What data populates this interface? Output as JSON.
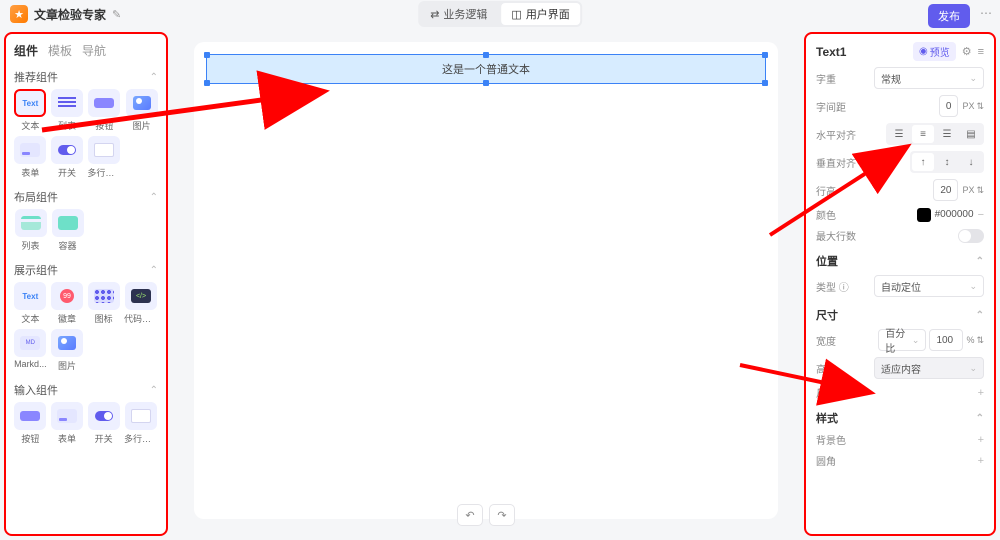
{
  "header": {
    "app_name": "文章检验专家",
    "tabs": {
      "logic": "业务逻辑",
      "ui": "用户界面"
    },
    "publish": "发布"
  },
  "left": {
    "tabs": {
      "components": "组件",
      "templates": "模板",
      "nav": "导航"
    },
    "group_reco": "推荐组件",
    "group_layout": "布局组件",
    "group_display": "展示组件",
    "group_input": "输入组件",
    "reco": {
      "text": "文本",
      "list": "列表",
      "button": "按钮",
      "image": "图片",
      "form": "表单",
      "switch": "开关",
      "multiline": "多行输..."
    },
    "layout": {
      "list": "列表",
      "container": "容器"
    },
    "display": {
      "text": "文本",
      "badge": "徽章",
      "chart": "图标",
      "code": "代码展...",
      "markdown": "Markd...",
      "image": "图片"
    },
    "input": {
      "button": "按钮",
      "form": "表单",
      "switch": "开关",
      "multiline": "多行输..."
    },
    "text_icon_label": "Text"
  },
  "canvas": {
    "text_content": "这是一个普通文本"
  },
  "right": {
    "title": "Text1",
    "preview": "预览",
    "font_weight_label": "字重",
    "font_weight_value": "常规",
    "letter_spacing_label": "字间距",
    "letter_spacing_value": "0",
    "letter_spacing_unit": "PX",
    "halign_label": "水平对齐",
    "valign_label": "垂直对齐",
    "line_height_label": "行高",
    "line_height_value": "20",
    "line_height_unit": "PX",
    "color_label": "颜色",
    "color_value": "#000000",
    "max_lines_label": "最大行数",
    "section_position": "位置",
    "type_label": "类型",
    "type_value": "自动定位",
    "section_size": "尺寸",
    "width_label": "宽度",
    "width_mode": "百分比",
    "width_value": "100",
    "width_unit": "%",
    "height_label": "高度",
    "height_value": "适应内容",
    "size_limit_label": "尺寸限制",
    "section_style": "样式",
    "bg_label": "背景色",
    "rad_label": "圆角"
  }
}
